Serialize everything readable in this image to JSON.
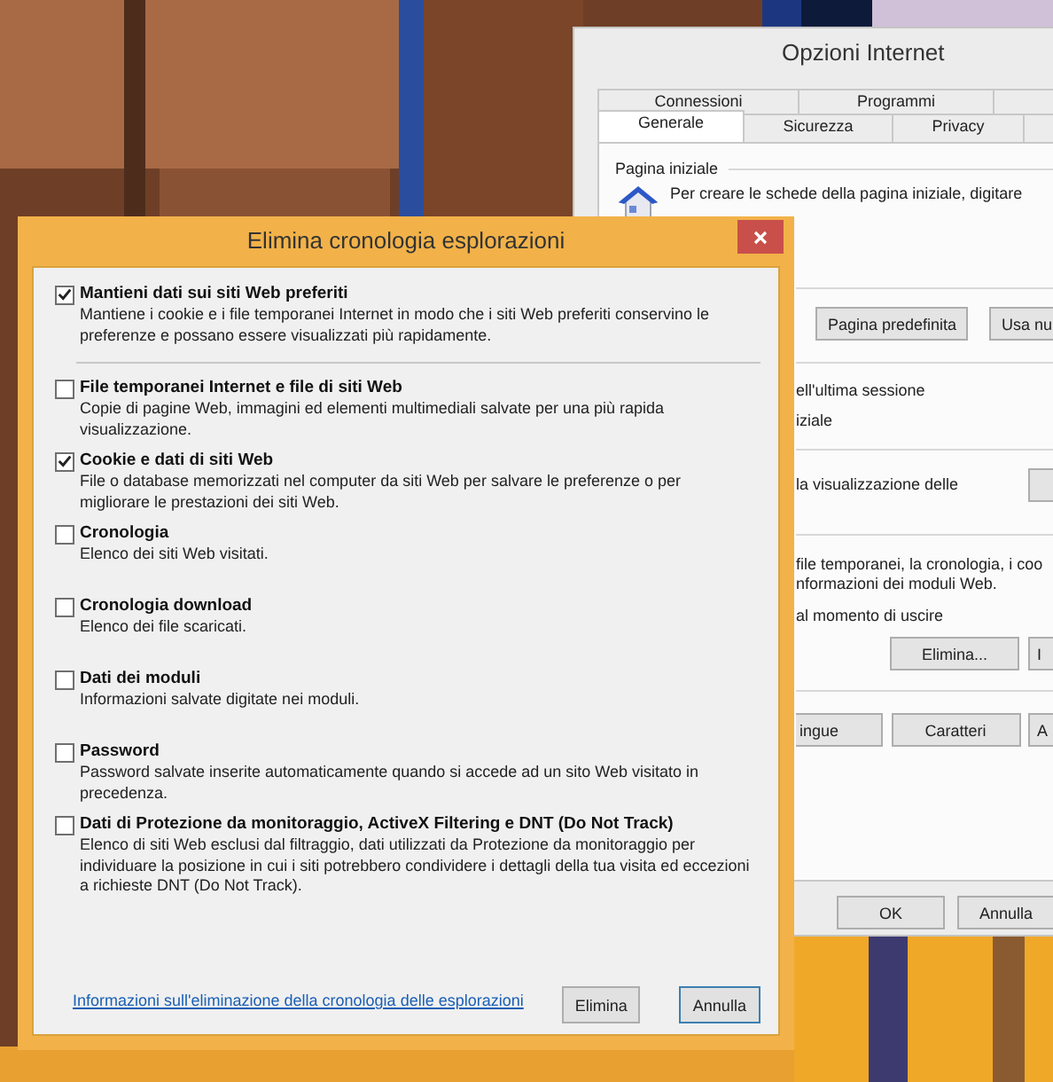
{
  "background_window": {
    "title": "Opzioni Internet",
    "tab_rows": [
      [
        {
          "label": "Connessioni",
          "selected": false
        },
        {
          "label": "Programmi",
          "selected": false
        }
      ],
      [
        {
          "label": "Generale",
          "selected": true
        },
        {
          "label": "Sicurezza",
          "selected": false
        },
        {
          "label": "Privacy",
          "selected": false
        }
      ]
    ],
    "home_page": {
      "heading": "Pagina iniziale",
      "lines": [
        "Per creare le schede della pagina iniziale, digitare"
      ]
    },
    "home_buttons": [
      "Pagina predefinita",
      "Usa nu"
    ],
    "startup_lines": [
      "ell'ultima sessione",
      "iziale"
    ],
    "tabs_line": "la visualizzazione delle",
    "history_lines": [
      "file temporanei, la cronologia, i coo",
      "nformazioni dei moduli Web.",
      "al momento di uscire"
    ],
    "history_buttons": [
      "Elimina...",
      "I"
    ],
    "appearance_buttons": [
      "ingue",
      "Caratteri",
      "A"
    ],
    "footer_buttons": [
      "OK",
      "Annulla"
    ]
  },
  "dialog": {
    "title": "Elimina cronologia esplorazioni",
    "preserve_option": {
      "title": "Mantieni dati sui siti Web preferiti",
      "description": "Mantiene i cookie e i file temporanei Internet in modo che i siti Web preferiti conservino le preferenze e possano essere visualizzati più rapidamente.",
      "checked": true
    },
    "options": [
      {
        "title": "File temporanei Internet e file di siti Web",
        "description": "Copie di pagine Web, immagini ed elementi multimediali salvate per una più rapida visualizzazione.",
        "checked": false
      },
      {
        "title": "Cookie e dati di siti Web",
        "description": "File o database memorizzati nel computer da siti Web per salvare le preferenze o per migliorare le prestazioni dei siti Web.",
        "checked": true
      },
      {
        "title": "Cronologia",
        "description": "Elenco dei siti Web visitati.",
        "checked": false
      },
      {
        "title": "Cronologia download",
        "description": "Elenco dei file scaricati.",
        "checked": false
      },
      {
        "title": "Dati dei moduli",
        "description": "Informazioni salvate digitate nei moduli.",
        "checked": false
      },
      {
        "title": "Password",
        "description": "Password salvate inserite automaticamente quando si accede ad un sito Web visitato in precedenza.",
        "checked": false
      },
      {
        "title": "Dati di Protezione da monitoraggio, ActiveX Filtering e DNT (Do Not Track)",
        "description": "Elenco di siti Web esclusi dal filtraggio, dati utilizzati da Protezione da monitoraggio per individuare la posizione in cui i siti potrebbero condividere i dettagli della tua visita ed eccezioni a richieste DNT (Do Not Track).",
        "checked": false
      }
    ],
    "link": "Informazioni sull'eliminazione della cronologia delle esplorazioni",
    "buttons": [
      {
        "label": "Elimina",
        "default": false
      },
      {
        "label": "Annulla",
        "default": true
      }
    ]
  }
}
